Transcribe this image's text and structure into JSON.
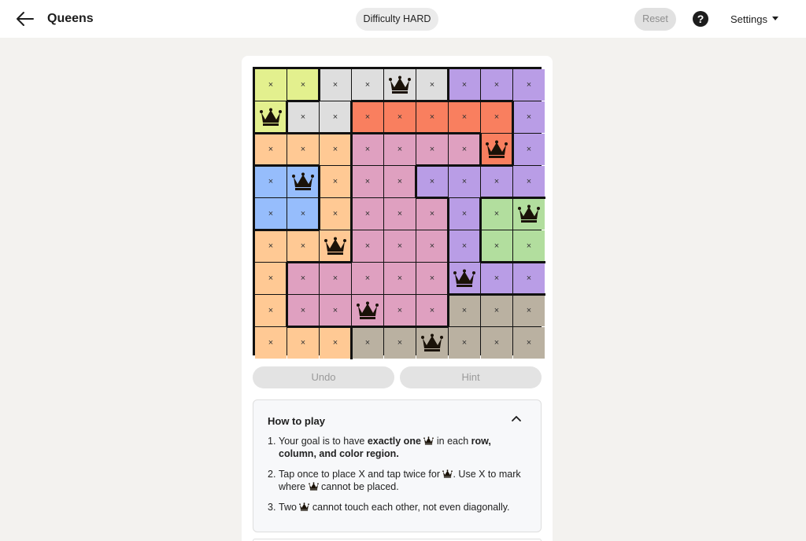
{
  "header": {
    "title": "Queens",
    "difficulty_label": "Difficulty HARD",
    "reset_label": "Reset",
    "help_label": "?",
    "settings_label": "Settings"
  },
  "colors": {
    "yellow": "#e3f08e",
    "gray": "#dedede",
    "red": "#f97f5f",
    "orange": "#ffc994",
    "pink": "#dfa0c0",
    "purple": "#b99de6",
    "blue": "#96bdfc",
    "green": "#b2de9e",
    "taupe": "#bab1a1"
  },
  "board": {
    "size": 9,
    "regions": [
      "YYGGGGPPP",
      "YGGRRRRRP",
      "OOOKKKKRP",
      "BBOKKPPPP",
      "BBOKKKPNN",
      "OOOKKKPNN",
      "OKKKKKPPP",
      "OKKKKKTTT",
      "OOOTTTTTT"
    ],
    "region_colors": {
      "Y": "yellow",
      "G": "gray",
      "R": "red",
      "O": "orange",
      "K": "pink",
      "P": "purple",
      "B": "blue",
      "N": "green",
      "T": "taupe"
    },
    "cells": [
      "xxxxQxxxx",
      "Qxxxxxxxx",
      "xxxxxxxQx",
      "xQxxxxxxx",
      "xxxxxxxxQ",
      "xxQxxxxxx",
      "xxxxxxQxx",
      "xxxQxxxxx",
      "xxxxxQxxx"
    ],
    "mark_glyph": "×",
    "queen_icon": "crown-icon"
  },
  "actions": {
    "undo_label": "Undo",
    "hint_label": "Hint"
  },
  "howto": {
    "title": "How to play",
    "step1": {
      "num": "1.",
      "a": "Your goal is to have ",
      "b": "exactly one",
      "c": " in each ",
      "d": "row, column, and color region."
    },
    "step2": {
      "num": "2.",
      "a": "Tap once to place X and tap twice for ",
      "b": ". Use X to mark where ",
      "c": " cannot be placed."
    },
    "step3": {
      "num": "3.",
      "a": "Two ",
      "b": " cannot touch each other, not even diagonally."
    }
  }
}
